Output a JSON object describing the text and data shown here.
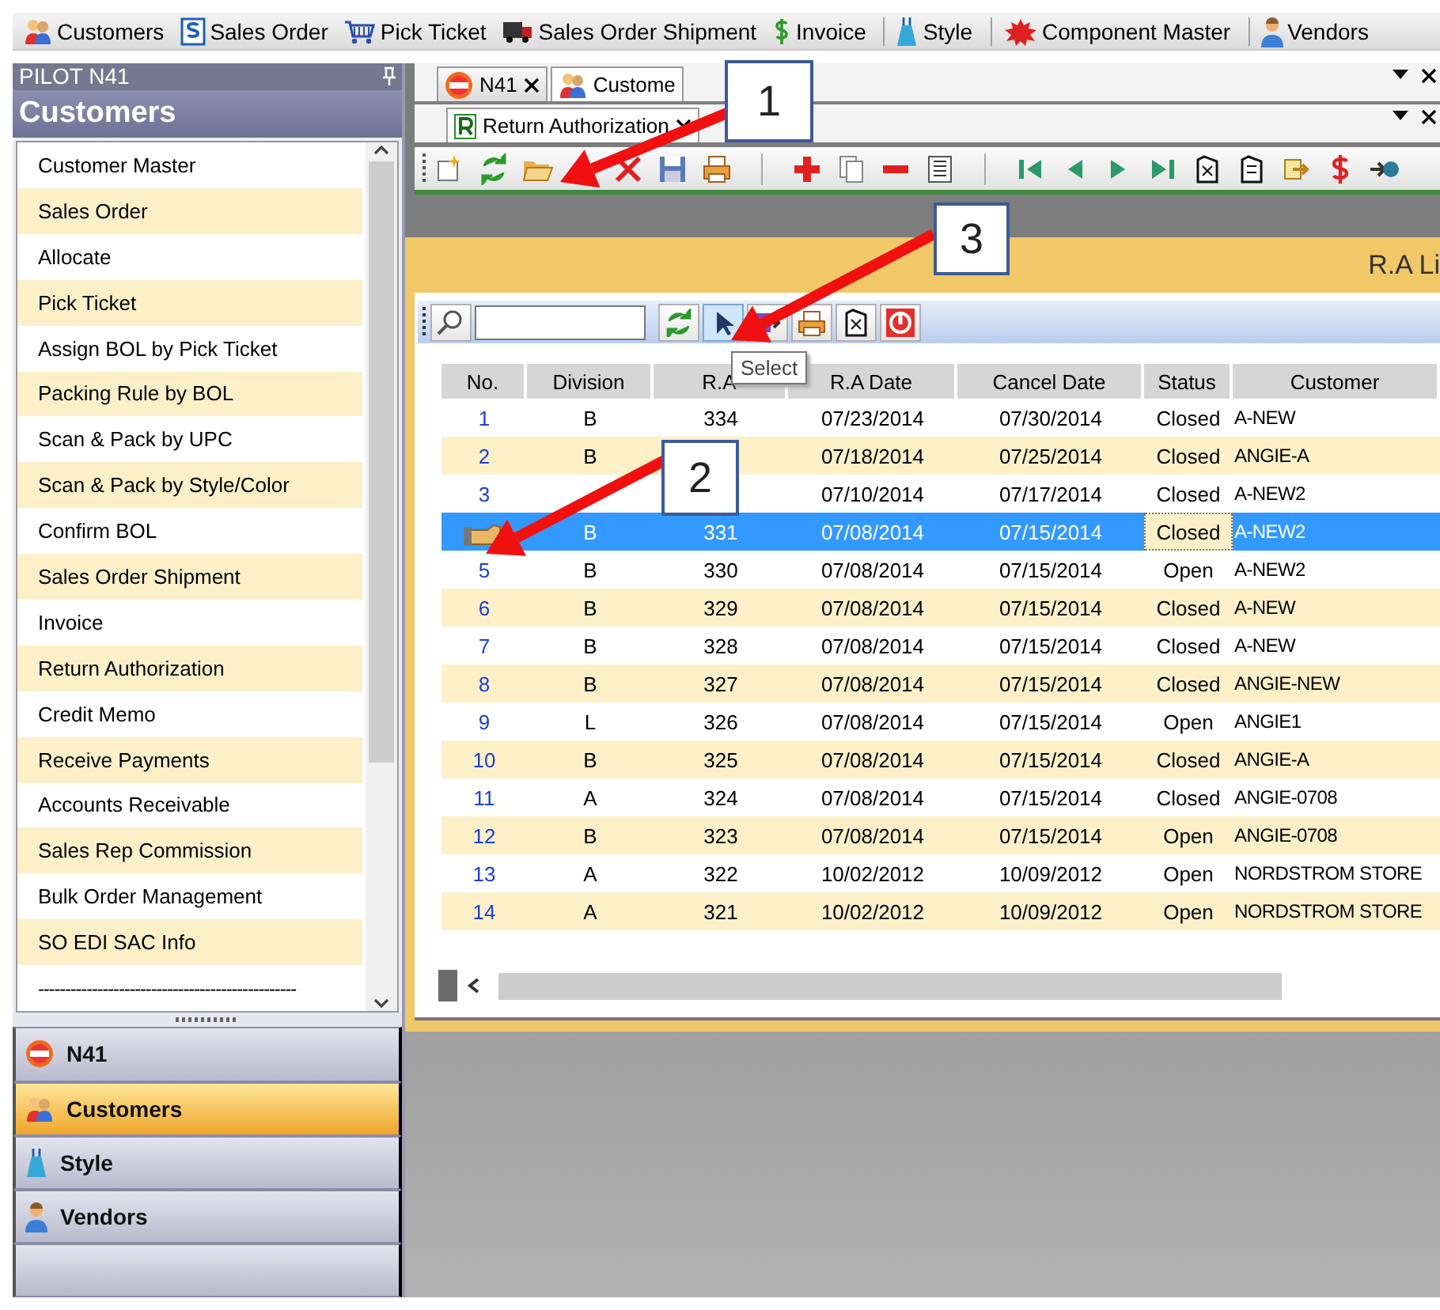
{
  "quick_bar": [
    {
      "kind": "button",
      "label": "Customers"
    },
    {
      "kind": "button",
      "label": "Sales Order"
    },
    {
      "kind": "button",
      "label": "Pick Ticket"
    },
    {
      "kind": "button",
      "label": "Sales Order Shipment"
    },
    {
      "kind": "button",
      "label": "Invoice"
    },
    {
      "kind": "separator"
    },
    {
      "kind": "button",
      "label": "Style"
    },
    {
      "kind": "separator"
    },
    {
      "kind": "button",
      "label": "Component Master"
    },
    {
      "kind": "separator"
    },
    {
      "kind": "button",
      "label": "Vendors"
    }
  ],
  "sidebar": {
    "workspace": "PILOT  N41",
    "title": "Customers",
    "items": [
      {
        "label": "Customer Master"
      },
      {
        "label": "Sales Order"
      },
      {
        "label": "Allocate"
      },
      {
        "label": "Pick Ticket"
      },
      {
        "label": "Assign BOL by Pick Ticket"
      },
      {
        "label": "Packing Rule by BOL"
      },
      {
        "label": "Scan & Pack by UPC"
      },
      {
        "label": "Scan & Pack by Style/Color"
      },
      {
        "label": "Confirm BOL"
      },
      {
        "label": "Sales Order Shipment"
      },
      {
        "label": "Invoice"
      },
      {
        "label": "Return Authorization"
      },
      {
        "label": "Credit Memo"
      },
      {
        "label": "Receive Payments"
      },
      {
        "label": "Accounts Receivable"
      },
      {
        "label": "Sales Rep Commission"
      },
      {
        "label": "Bulk Order Management"
      },
      {
        "label": "SO EDI SAC Info"
      },
      {
        "label": "------------------------------------------------"
      }
    ],
    "nav": [
      {
        "label": "N41",
        "selected": false
      },
      {
        "label": "Customers",
        "selected": true
      },
      {
        "label": "Style",
        "selected": false
      },
      {
        "label": "Vendors",
        "selected": false
      },
      {
        "selected": false
      }
    ]
  },
  "tabs": [
    {
      "label": "N41",
      "selected": false
    },
    {
      "label": "Custome",
      "selected": true
    }
  ],
  "doc_tabs": [
    {
      "label": "Return Authorization",
      "selected": true
    }
  ],
  "ra_window": {
    "title": "R.A Li",
    "tooltip": "Select",
    "columns": [
      "No.",
      "Division",
      "R.A",
      "R.A Date",
      "Cancel Date",
      "Status",
      "Customer"
    ],
    "rows": [
      {
        "no": "1",
        "division": "B",
        "ra": "334",
        "ra_date": "07/23/2014",
        "cancel_date": "07/30/2014",
        "status": "Closed",
        "customer": "A-NEW",
        "selected": false
      },
      {
        "no": "2",
        "division": "B",
        "ra_date": "07/18/2014",
        "cancel_date": "07/25/2014",
        "status": "Closed",
        "customer": "ANGIE-A",
        "selected": false
      },
      {
        "no": "3",
        "ra_date": "07/10/2014",
        "cancel_date": "07/17/2014",
        "status": "Closed",
        "customer": "A-NEW2",
        "selected": false
      },
      {
        "division": "B",
        "ra": "331",
        "ra_date": "07/08/2014",
        "cancel_date": "07/15/2014",
        "status": "Closed",
        "customer": "A-NEW2",
        "selected": true
      },
      {
        "no": "5",
        "division": "B",
        "ra": "330",
        "ra_date": "07/08/2014",
        "cancel_date": "07/15/2014",
        "status": "Open",
        "customer": "A-NEW2",
        "selected": false
      },
      {
        "no": "6",
        "division": "B",
        "ra": "329",
        "ra_date": "07/08/2014",
        "cancel_date": "07/15/2014",
        "status": "Closed",
        "customer": "A-NEW",
        "selected": false
      },
      {
        "no": "7",
        "division": "B",
        "ra": "328",
        "ra_date": "07/08/2014",
        "cancel_date": "07/15/2014",
        "status": "Closed",
        "customer": "A-NEW",
        "selected": false
      },
      {
        "no": "8",
        "division": "B",
        "ra": "327",
        "ra_date": "07/08/2014",
        "cancel_date": "07/15/2014",
        "status": "Closed",
        "customer": "ANGIE-NEW",
        "selected": false
      },
      {
        "no": "9",
        "division": "L",
        "ra": "326",
        "ra_date": "07/08/2014",
        "cancel_date": "07/15/2014",
        "status": "Open",
        "customer": "ANGIE1",
        "selected": false
      },
      {
        "no": "10",
        "division": "B",
        "ra": "325",
        "ra_date": "07/08/2014",
        "cancel_date": "07/15/2014",
        "status": "Closed",
        "customer": "ANGIE-A",
        "selected": false
      },
      {
        "no": "11",
        "division": "A",
        "ra": "324",
        "ra_date": "07/08/2014",
        "cancel_date": "07/15/2014",
        "status": "Closed",
        "customer": "ANGIE-0708",
        "selected": false
      },
      {
        "no": "12",
        "division": "B",
        "ra": "323",
        "ra_date": "07/08/2014",
        "cancel_date": "07/15/2014",
        "status": "Open",
        "customer": "ANGIE-0708",
        "selected": false
      },
      {
        "no": "13",
        "division": "A",
        "ra": "322",
        "ra_date": "10/02/2012",
        "cancel_date": "10/09/2012",
        "status": "Open",
        "customer": "NORDSTROM STORE",
        "selected": false
      },
      {
        "no": "14",
        "division": "A",
        "ra": "321",
        "ra_date": "10/02/2012",
        "cancel_date": "10/09/2012",
        "status": "Open",
        "customer": "NORDSTROM STORE",
        "selected": false
      }
    ]
  },
  "callouts": [
    {
      "label": "1"
    },
    {
      "label": "2"
    },
    {
      "label": "3"
    }
  ]
}
